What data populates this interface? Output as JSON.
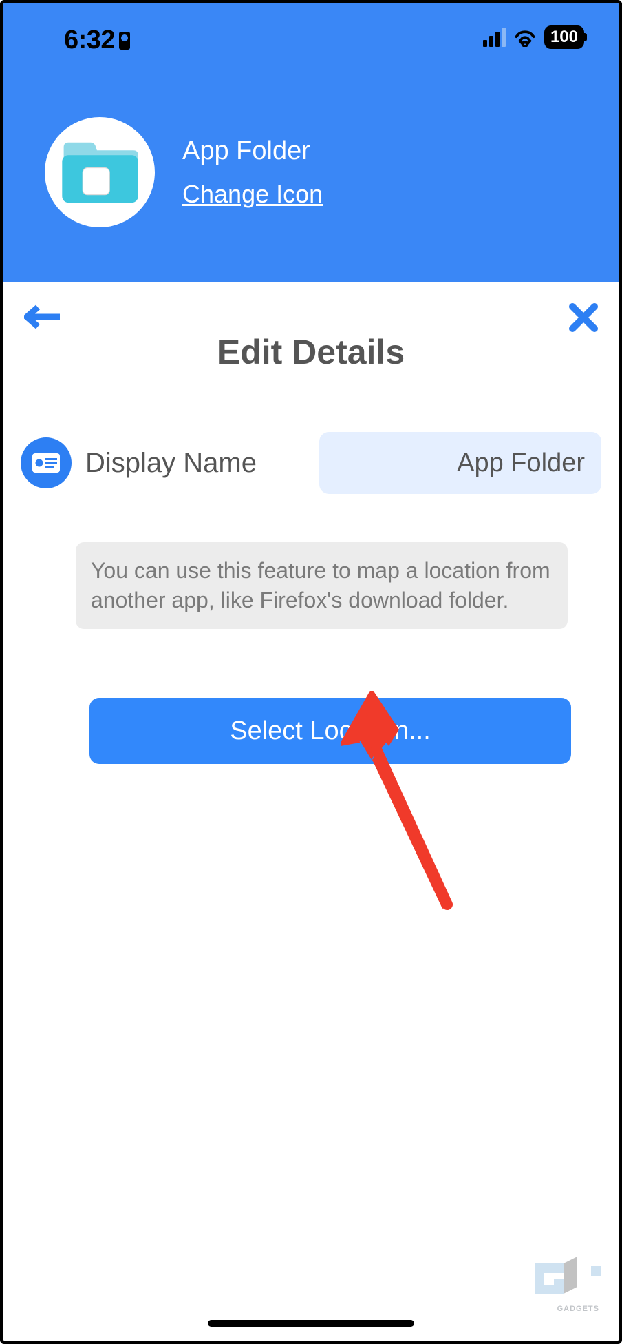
{
  "status": {
    "time": "6:32",
    "battery": "100"
  },
  "header": {
    "title": "App Folder",
    "change_icon_label": "Change Icon"
  },
  "page": {
    "title": "Edit Details"
  },
  "field": {
    "label": "Display Name",
    "value": "App Folder"
  },
  "info": {
    "text": "You can use this feature to map a location from another app, like Firefox's download folder."
  },
  "actions": {
    "select_location_label": "Select Location..."
  },
  "watermark": {
    "text": "GADGETS"
  }
}
